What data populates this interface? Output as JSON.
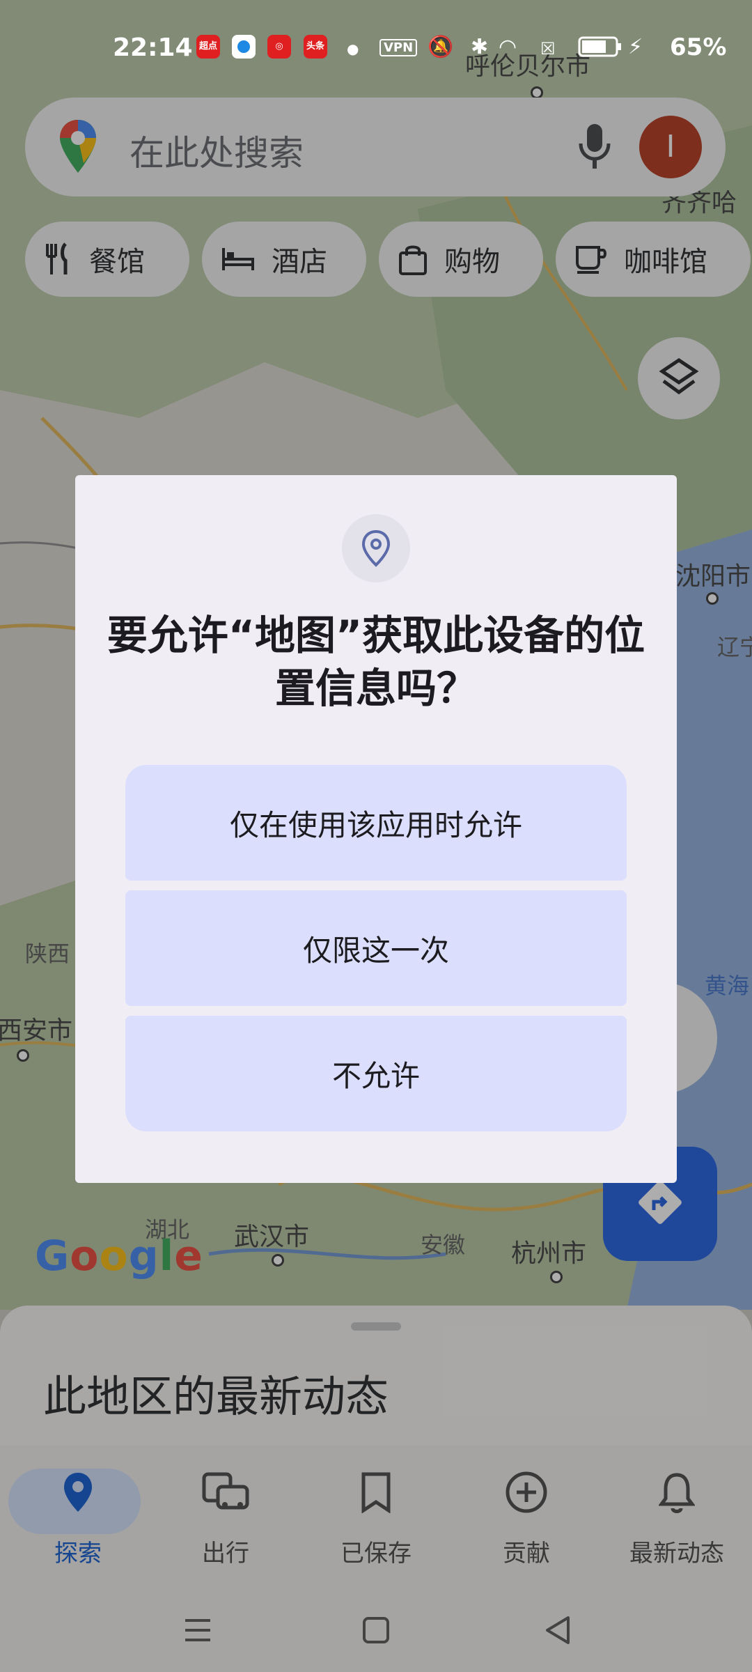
{
  "status_bar": {
    "time": "22:14",
    "vpn": "VPN",
    "battery": "65%",
    "app_icons": [
      "超点",
      "头条"
    ]
  },
  "search": {
    "placeholder": "在此处搜索",
    "avatar_letter": "I"
  },
  "chips": [
    {
      "icon": "restaurant-icon",
      "label": "餐馆"
    },
    {
      "icon": "hotel-icon",
      "label": "酒店"
    },
    {
      "icon": "shopping-bag-icon",
      "label": "购物"
    },
    {
      "icon": "coffee-icon",
      "label": "咖啡馆"
    }
  ],
  "map": {
    "logo_text": "Google",
    "labels": [
      "呼伦贝尔市",
      "齐齐哈",
      "沈阳市",
      "辽宁",
      "陕西",
      "西安市",
      "黄海",
      "湖北",
      "武汉市",
      "安徽",
      "杭州市"
    ]
  },
  "dialog": {
    "question": "要允许“地图”获取此设备的位置信息吗？",
    "options": [
      "仅在使用该应用时允许",
      "仅限这一次",
      "不允许"
    ]
  },
  "sheet": {
    "title": "此地区的最新动态"
  },
  "nav": {
    "items": [
      {
        "label": "探索",
        "icon": "explore-pin-icon",
        "active": true
      },
      {
        "label": "出行",
        "icon": "commute-icon",
        "active": false
      },
      {
        "label": "已保存",
        "icon": "bookmark-icon",
        "active": false
      },
      {
        "label": "贡献",
        "icon": "add-circle-icon",
        "active": false
      },
      {
        "label": "最新动态",
        "icon": "bell-icon",
        "active": false
      }
    ]
  },
  "colors": {
    "accent": "#0b57d0",
    "dialog_button": "#dbdefc",
    "dialog_bg": "#f0edf5",
    "avatar": "#b33316"
  }
}
